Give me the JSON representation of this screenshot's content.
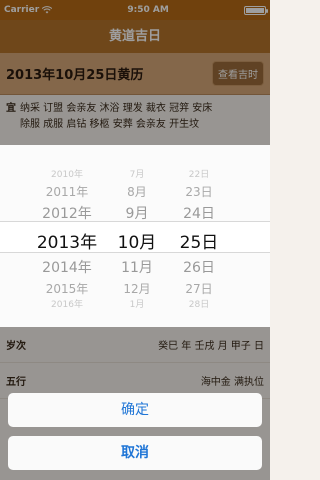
{
  "status_bar": {
    "carrier": "Carrier",
    "time": "9:50 AM"
  },
  "nav": {
    "title": "黄道吉日"
  },
  "date_header": {
    "title": "2013年10月25日黄历",
    "check_button": "查看吉时"
  },
  "yi": {
    "label": "宜",
    "line1": "纳采 订盟 会亲友 沐浴 理发 裁衣 冠笄 安床",
    "line2": "除服 成服 启钻 移柩 安葬 会亲友 开生坟"
  },
  "picker": {
    "years": [
      "2010年",
      "2011年",
      "2012年",
      "2013年",
      "2014年",
      "2015年",
      "2016年"
    ],
    "months": [
      "7月",
      "8月",
      "9月",
      "10月",
      "11月",
      "12月",
      "1月"
    ],
    "days": [
      "22日",
      "23日",
      "24日",
      "25日",
      "26日",
      "27日",
      "28日"
    ],
    "selected": {
      "year": "2013年",
      "month": "10月",
      "day": "25日"
    }
  },
  "rows": [
    {
      "label": "岁次",
      "value": "癸巳 年 壬戌 月 甲子 日"
    },
    {
      "label": "五行",
      "value": "海中金 满执位"
    }
  ],
  "actions": {
    "confirm": "确定",
    "cancel": "取消"
  }
}
